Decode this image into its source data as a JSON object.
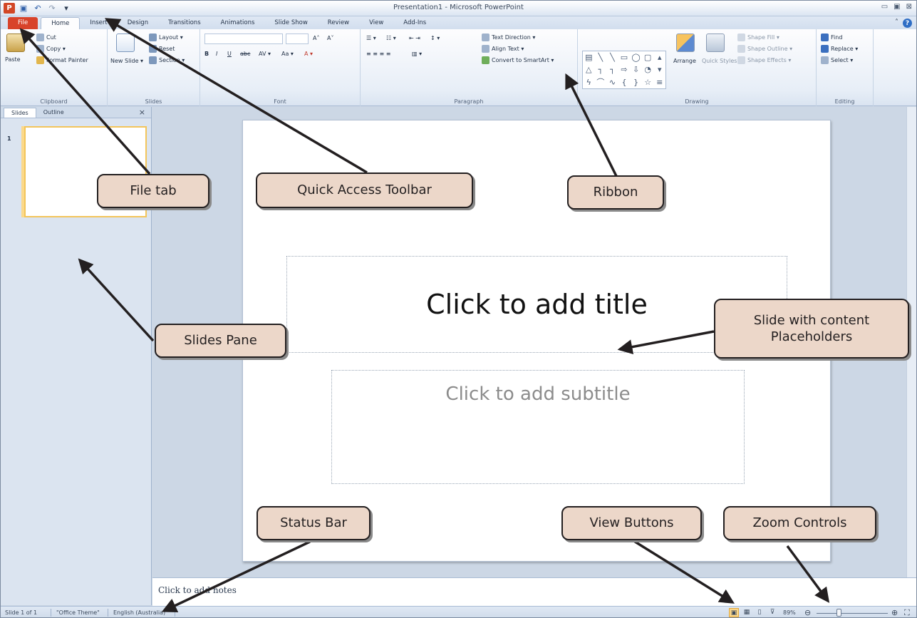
{
  "window": {
    "title": "Presentation1 - Microsoft PowerPoint",
    "qat_undo": "↶",
    "qat_redo": "↷",
    "qat_save": "▣",
    "qat_logo": "P",
    "qat_customize": "▾"
  },
  "tabs": [
    "File",
    "Home",
    "Insert",
    "Design",
    "Transitions",
    "Animations",
    "Slide Show",
    "Review",
    "View",
    "Add-Ins"
  ],
  "ribbon": {
    "clipboard": {
      "label": "Clipboard",
      "paste": "Paste",
      "cut": "Cut",
      "copy": "Copy ▾",
      "format_painter": "Format Painter"
    },
    "slides": {
      "label": "Slides",
      "new_slide": "New Slide ▾",
      "layout": "Layout ▾",
      "reset": "Reset",
      "section": "Section ▾"
    },
    "font": {
      "label": "Font",
      "grow": "A˄",
      "shrink": "A˅",
      "bold": "B",
      "italic": "I",
      "underline": "U",
      "strike": "abc",
      "spacing": "AV ▾",
      "case": "Aa ▾",
      "color": "A ▾"
    },
    "paragraph": {
      "label": "Paragraph",
      "text_direction": "Text Direction ▾",
      "align_text": "Align Text ▾",
      "convert_smartart": "Convert to SmartArt ▾"
    },
    "drawing": {
      "label": "Drawing",
      "arrange": "Arrange",
      "quick_styles": "Quick Styles ▾",
      "shape_fill": "Shape Fill ▾",
      "shape_outline": "Shape Outline ▾",
      "shape_effects": "Shape Effects ▾"
    },
    "editing": {
      "label": "Editing",
      "find": "Find",
      "replace": "Replace ▾",
      "select": "Select ▾"
    }
  },
  "pane": {
    "tab_slides": "Slides",
    "tab_outline": "Outline",
    "close": "×",
    "thumb_number": "1"
  },
  "slide": {
    "title_placeholder": "Click to add title",
    "subtitle_placeholder": "Click to add subtitle"
  },
  "notes": {
    "placeholder": "Click to add notes"
  },
  "statusbar": {
    "slide_count": "Slide 1 of 1",
    "theme": "\"Office Theme\"",
    "language": "English (Australia)",
    "zoom": "89%"
  },
  "callouts": {
    "file_tab": "File tab",
    "qat": "Quick Access Toolbar",
    "ribbon": "Ribbon",
    "slides_pane": "Slides Pane",
    "placeholders_line1": "Slide with content",
    "placeholders_line2": "Placeholders",
    "status_bar": "Status Bar",
    "view_buttons": "View Buttons",
    "zoom_controls": "Zoom Controls"
  },
  "colors": {
    "file_tab": "#d8432a",
    "callout_fill": "#ecd7c9",
    "ribbon_bg": "#e7eef7",
    "workspace": "#ccd7e5"
  }
}
